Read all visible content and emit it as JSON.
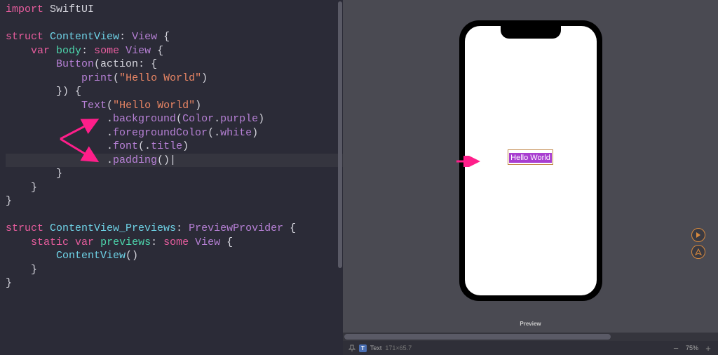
{
  "code": {
    "l0_kw": "import",
    "l0_mod": "SwiftUI",
    "l1_kw1": "struct",
    "l1_name": "ContentView",
    "l1_proto": "View",
    "l2_kw1": "var",
    "l2_name": "body",
    "l2_kw2": "some",
    "l2_type": "View",
    "l3_call": "Button",
    "l3_arg": "action",
    "l4_fn": "print",
    "l4_str": "\"Hello World\"",
    "l5_close": "}) {",
    "l6_call": "Text",
    "l6_str": "\"Hello World\"",
    "l7_m": "background",
    "l7_a": "Color",
    "l7_b": "purple",
    "l8_m": "foregroundColor",
    "l8_a": "white",
    "l9_m": "font",
    "l9_a": "title",
    "l10_m": "padding",
    "l_close": "}",
    "p_kw1": "struct",
    "p_name": "ContentView_Previews",
    "p_proto": "PreviewProvider",
    "p2_kw1": "static",
    "p2_kw2": "var",
    "p2_name": "previews",
    "p2_kw3": "some",
    "p2_type": "View",
    "p3_call": "ContentView"
  },
  "preview": {
    "button_text": "Hello World",
    "label": "Preview"
  },
  "bottom": {
    "type_badge": "T",
    "selection_name": "Text",
    "selection_dims": "171×65.7",
    "zoom": "75%"
  }
}
